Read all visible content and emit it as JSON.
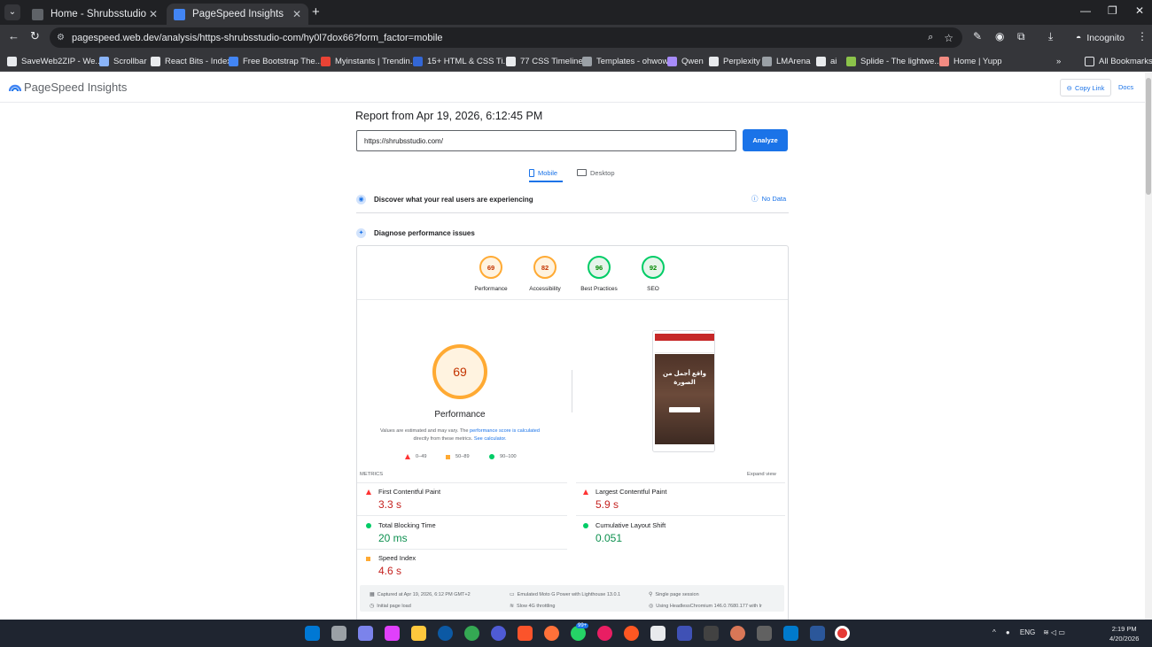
{
  "browser": {
    "tabs": [
      {
        "title": "Home - Shrubsstudio"
      },
      {
        "title": "PageSpeed Insights"
      }
    ],
    "url": "pagespeed.web.dev/analysis/https-shrubsstudio-com/hy0l7dox66?form_factor=mobile",
    "incognito_label": "Incognito",
    "bookmarks": [
      {
        "label": "SaveWeb2ZIP - We...",
        "color": "#e8eaed"
      },
      {
        "label": "Scrollbar",
        "color": "#8ab4f8"
      },
      {
        "label": "React Bits - Index",
        "color": "#e8eaed"
      },
      {
        "label": "Free Bootstrap The...",
        "color": "#4285f4"
      },
      {
        "label": "Myinstants | Trendin...",
        "color": "#ea4335"
      },
      {
        "label": "15+ HTML & CSS Ti...",
        "color": "#3367d6"
      },
      {
        "label": "77 CSS Timelines",
        "color": "#e8eaed"
      },
      {
        "label": "Templates - ohwow",
        "color": "#9aa0a6"
      },
      {
        "label": "Qwen",
        "color": "#a78bfa"
      },
      {
        "label": "Perplexity",
        "color": "#e8eaed"
      },
      {
        "label": "LMArena",
        "color": "#9aa0a6"
      },
      {
        "label": "ai",
        "color": "#e8eaed"
      },
      {
        "label": "Splide - The lightwe...",
        "color": "#8bc34a"
      },
      {
        "label": "Home | Yupp",
        "color": "#f28b82"
      }
    ],
    "all_bookmarks": "All Bookmarks",
    "more_bookmarks": "»"
  },
  "psi": {
    "brand": "PageSpeed Insights",
    "copy_link": "Copy Link",
    "docs": "Docs",
    "report_title": "Report from Apr 19, 2026, 6:12:45 PM",
    "url_value": "https://shrubsstudio.com/",
    "analyze": "Analyze",
    "tab_mobile": "Mobile",
    "tab_desktop": "Desktop",
    "real_users": "Discover what your real users are experiencing",
    "no_data": "No Data",
    "diagnose": "Diagnose performance issues",
    "categories": [
      {
        "score": "69",
        "label": "Performance",
        "status": "orange"
      },
      {
        "score": "82",
        "label": "Accessibility",
        "status": "orange"
      },
      {
        "score": "96",
        "label": "Best Practices",
        "status": "green"
      },
      {
        "score": "92",
        "label": "SEO",
        "status": "green"
      }
    ],
    "performance_score": "69",
    "performance_score_fraction": 0.69,
    "performance_label": "Performance",
    "desc_1": "Values are estimated and may vary. The",
    "desc_link1": "performance score is calculated",
    "desc_2": "directly from these metrics.",
    "desc_link2": "See calculator.",
    "legend": {
      "poor": "0–49",
      "average": "50–89",
      "good": "90–100"
    },
    "metrics_heading": "METRICS",
    "expand_view": "Expand view",
    "metrics": [
      {
        "name": "First Contentful Paint",
        "value": "3.3 s",
        "status": "red"
      },
      {
        "name": "Largest Contentful Paint",
        "value": "5.9 s",
        "status": "red"
      },
      {
        "name": "Total Blocking Time",
        "value": "20 ms",
        "status": "green"
      },
      {
        "name": "Cumulative Layout Shift",
        "value": "0.051",
        "status": "green"
      },
      {
        "name": "Speed Index",
        "value": "4.6 s",
        "status": "orange"
      }
    ],
    "footer": {
      "captured": "Captured at Apr 19, 2026, 6:12 PM GMT+2",
      "emulated": "Emulated Moto G Power with Lighthouse 13.0.1",
      "session": "Single page session",
      "initial": "Initial page load",
      "throttling": "Slow 4G throttling",
      "using": "Using HeadlessChromium 146.0.7680.177 with lr"
    },
    "phone_headline": "واقع أجمل من الصورة"
  },
  "taskbar": {
    "tray_lang": "ENG",
    "time": "2:19 PM",
    "date": "4/20/2026",
    "badge": "99+"
  }
}
